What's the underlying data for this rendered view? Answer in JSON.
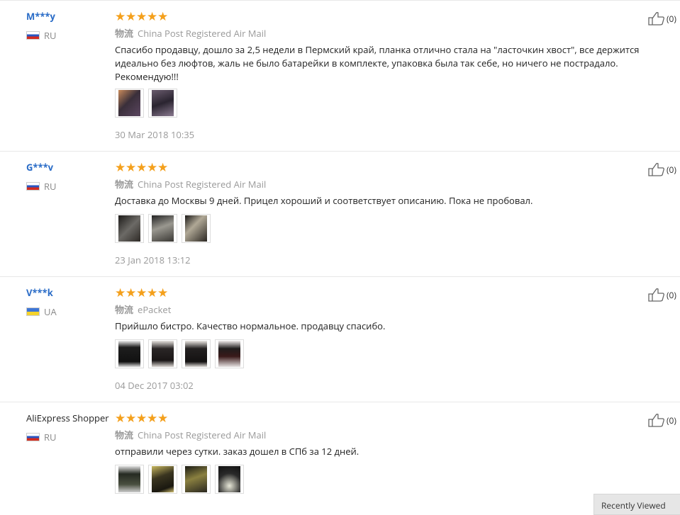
{
  "reviews": [
    {
      "user": "M***y",
      "country": "RU",
      "flag": "ru",
      "shipping_label": "物流",
      "shipping": "China Post Registered Air Mail",
      "text": "Спасибо продавцу, дошло за 2,5 недели в Пермский край, планка отлично стала на \"ласточкин хвост\", все держится идеально без люфтов, жаль не было батарейки в комплекте, упаковка была так себе, но ничего не пострадало. Рекомендую!!!",
      "photos": [
        "#3a2f3a",
        "#4a4052"
      ],
      "date": "30 Mar 2018 10:35",
      "helpful": "(0)"
    },
    {
      "user": "G***v",
      "country": "RU",
      "flag": "ru",
      "shipping_label": "物流",
      "shipping": "China Post Registered Air Mail",
      "text": "Доставка до Москвы 9 дней. Прицел хороший и соответствует описанию. Пока не пробовал.",
      "photos": [
        "#2e2a26",
        "#3a3834",
        "#2b2722"
      ],
      "date": "23 Jan 2018 13:12",
      "helpful": "(0)"
    },
    {
      "user": "V***k",
      "country": "UA",
      "flag": "ua",
      "shipping_label": "物流",
      "shipping": "ePacket",
      "text": "Прийшло бистро. Качество нормальное. продавцу спасибо.",
      "photos": [
        "#1e1e1e",
        "#2a2626",
        "#232020",
        "#1f1c1c"
      ],
      "date": "04 Dec 2017 03:02",
      "helpful": "(0)"
    },
    {
      "user": "AliExpress Shopper",
      "country": "RU",
      "flag": "ru",
      "shipping_label": "物流",
      "shipping": "China Post Registered Air Mail",
      "text": "отправили через сутки. заказ дошел в СПб за 12 дней.",
      "photos": [
        "#262a22",
        "#3a3520",
        "#2a2820",
        "#2a2a2a"
      ],
      "date": "",
      "helpful": "(0)"
    }
  ],
  "recently_viewed": "Recently Viewed",
  "star_glyph": "★"
}
